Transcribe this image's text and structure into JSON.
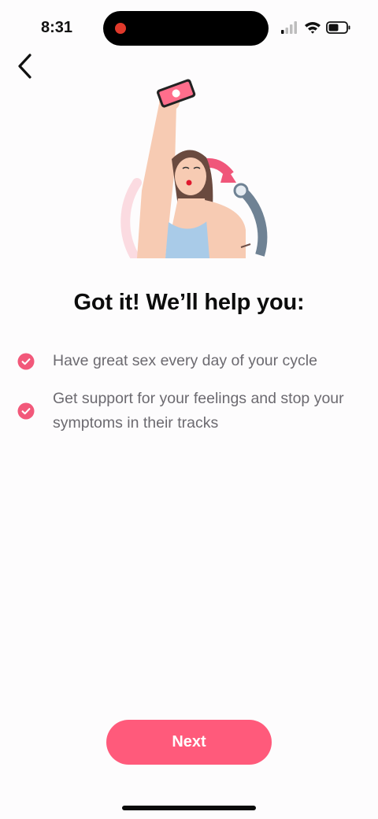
{
  "status_bar": {
    "time": "8:31",
    "icons": [
      "signal-icon",
      "wifi-icon",
      "battery-icon"
    ],
    "recording_color": "#e0392b"
  },
  "navigation": {
    "back_icon": "chevron-left-icon"
  },
  "hero": {
    "image": "woman-taking-selfie-illustration"
  },
  "headline": "Got it! We’ll help you:",
  "benefits": [
    {
      "text": "Have great sex every day of your cycle",
      "icon": "check-circle-icon"
    },
    {
      "text": "Get support for your feelings and stop your symptoms in their tracks",
      "icon": "check-circle-icon"
    }
  ],
  "next_button": {
    "label": "Next"
  },
  "colors": {
    "accent": "#ff5a7b",
    "background": "#fdfcfd",
    "text_secondary": "#6c6a70"
  }
}
